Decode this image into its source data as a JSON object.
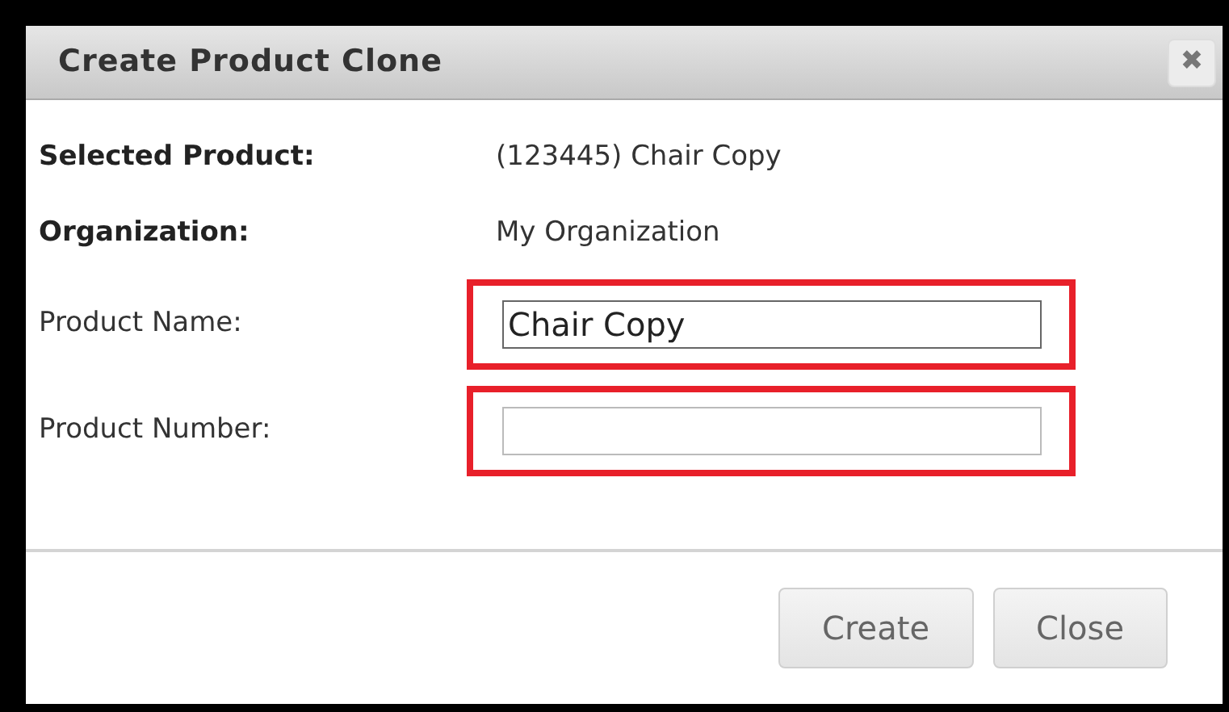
{
  "dialog": {
    "title": "Create Product Clone",
    "close_icon": "✖"
  },
  "info_rows": [
    {
      "label": "Selected Product:",
      "value": "(123445) Chair Copy"
    },
    {
      "label": "Organization:",
      "value": "My Organization"
    }
  ],
  "fields": [
    {
      "label": "Product Name:",
      "value": "Chair Copy",
      "highlighted": true
    },
    {
      "label": "Product Number:",
      "highlighted": true
    }
  ],
  "buttons": [
    "Create",
    "Close"
  ]
}
